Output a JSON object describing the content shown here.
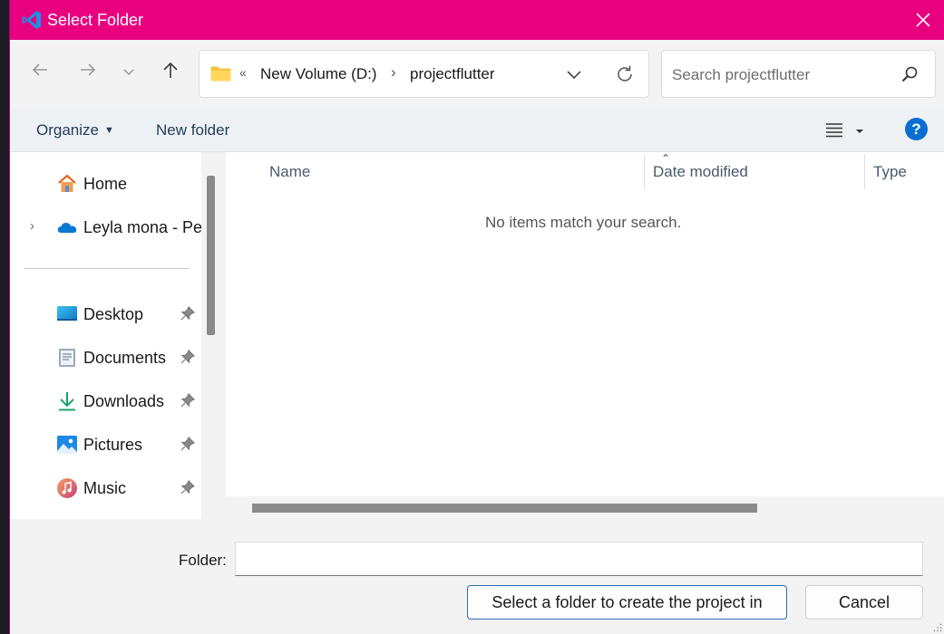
{
  "window": {
    "title": "Select Folder",
    "accent_color": "#e8007f",
    "icon": "vscode-icon"
  },
  "nav": {
    "back_icon": "arrow-left-icon",
    "forward_icon": "arrow-right-icon",
    "recent_icon": "chevron-down-icon",
    "up_icon": "arrow-up-icon"
  },
  "address": {
    "overflow": "«",
    "breadcrumbs": [
      "New Volume (D:)",
      "projectflutter"
    ],
    "separator": "›"
  },
  "search": {
    "placeholder": "Search projectflutter"
  },
  "toolbar": {
    "organize_label": "Organize",
    "new_folder_label": "New folder",
    "help_label": "?"
  },
  "sidebar": {
    "items": [
      {
        "label": "Home",
        "icon": "home-icon",
        "pinned": false,
        "expandable": false
      },
      {
        "label": "Leyla mona - Pers",
        "icon": "onedrive-icon",
        "pinned": false,
        "expandable": true
      },
      {
        "label": "Desktop",
        "icon": "desktop-icon",
        "pinned": true
      },
      {
        "label": "Documents",
        "icon": "documents-icon",
        "pinned": true
      },
      {
        "label": "Downloads",
        "icon": "downloads-icon",
        "pinned": true
      },
      {
        "label": "Pictures",
        "icon": "pictures-icon",
        "pinned": true
      },
      {
        "label": "Music",
        "icon": "music-icon",
        "pinned": true
      }
    ]
  },
  "content": {
    "columns": [
      "Name",
      "Date modified",
      "Type"
    ],
    "empty_message": "No items match your search."
  },
  "footer": {
    "folder_label": "Folder:",
    "folder_value": "",
    "primary_button": "Select a folder to create the project in",
    "cancel_button": "Cancel"
  }
}
